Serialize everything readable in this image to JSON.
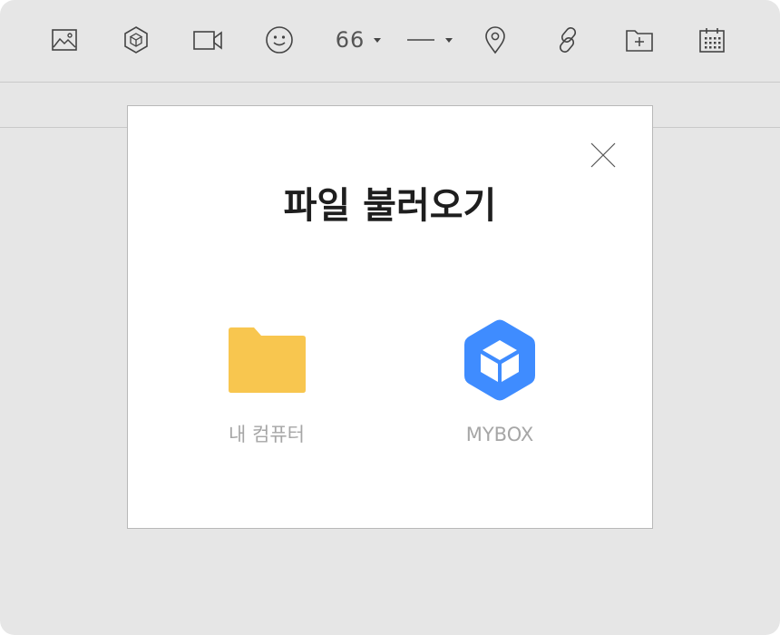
{
  "toolbar": {
    "items": [
      {
        "name": "image-icon"
      },
      {
        "name": "cube-box-icon"
      },
      {
        "name": "video-camera-icon"
      },
      {
        "name": "emoticon-icon"
      },
      {
        "name": "quote-icon",
        "label": "66"
      },
      {
        "name": "divider-line-icon"
      },
      {
        "name": "map-pin-icon"
      },
      {
        "name": "link-icon"
      },
      {
        "name": "folder-add-icon"
      },
      {
        "name": "calendar-icon"
      }
    ]
  },
  "dialog": {
    "title": "파일 불러오기",
    "close_icon": "close-icon",
    "options": [
      {
        "label": "내 컴퓨터",
        "icon": "folder-icon",
        "color": "#f8c64f"
      },
      {
        "label": "MYBOX",
        "icon": "mybox-cube-icon",
        "color": "#3f8cff"
      }
    ]
  },
  "colors": {
    "background": "#e6e6e6",
    "dialog_background": "#ffffff",
    "label": "#a6a6a6",
    "title": "#1e1e1e"
  }
}
